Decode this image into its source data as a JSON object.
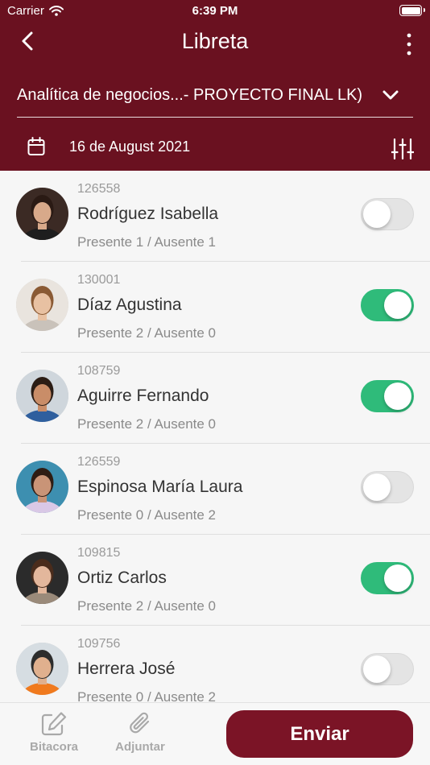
{
  "status_bar": {
    "carrier": "Carrier",
    "time": "6:39 PM"
  },
  "nav": {
    "title": "Libreta"
  },
  "course": {
    "name": "Analítica de negocios...- PROYECTO FINAL  LK)"
  },
  "date": {
    "label": "16 de August 2021"
  },
  "students": [
    {
      "id": "126558",
      "name": "Rodríguez Isabella",
      "stats": "Presente 1 / Ausente 1",
      "present": false,
      "avatar_bg": "#3b2a24",
      "skin": "#d8a98a",
      "hair": "#2a1a14",
      "shirt": "#1e1e1e"
    },
    {
      "id": "130001",
      "name": "Díaz Agustina",
      "stats": "Presente 2 / Ausente 0",
      "present": true,
      "avatar_bg": "#e9e4de",
      "skin": "#e8c1a2",
      "hair": "#8a5a34",
      "shirt": "#c9c2ba"
    },
    {
      "id": "108759",
      "name": "Aguirre Fernando",
      "stats": "Presente 2 / Ausente 0",
      "present": true,
      "avatar_bg": "#cfd6dc",
      "skin": "#c98d68",
      "hair": "#2b1d15",
      "shirt": "#2f5f9e"
    },
    {
      "id": "126559",
      "name": "Espinosa María Laura",
      "stats": "Presente 0 / Ausente 2",
      "present": false,
      "avatar_bg": "#3d8fb0",
      "skin": "#c99477",
      "hair": "#2e1c13",
      "shirt": "#d9c8e6"
    },
    {
      "id": "109815",
      "name": "Ortiz Carlos",
      "stats": "Presente 2 / Ausente 0",
      "present": true,
      "avatar_bg": "#2b2b2b",
      "skin": "#e3b79c",
      "hair": "#4a2c1c",
      "shirt": "#9a8a7a"
    },
    {
      "id": "109756",
      "name": "Herrera José",
      "stats": "Presente 0 / Ausente 2",
      "present": false,
      "avatar_bg": "#d6dde2",
      "skin": "#e0b08e",
      "hair": "#2c2c2c",
      "shirt": "#f07a1e"
    }
  ],
  "bottom_bar": {
    "bitacora_label": "Bitacora",
    "adjuntar_label": "Adjuntar",
    "send_label": "Enviar"
  },
  "colors": {
    "header": "#6a1120",
    "toggle_on": "#2fbb7a",
    "send_button": "#7b1426"
  },
  "icons": {
    "back": "chevron-left-icon",
    "more": "more-vertical-icon",
    "dropdown": "chevron-down-icon",
    "calendar": "calendar-icon",
    "filter": "sliders-icon",
    "bitacora": "edit-icon",
    "adjuntar": "paperclip-icon"
  }
}
